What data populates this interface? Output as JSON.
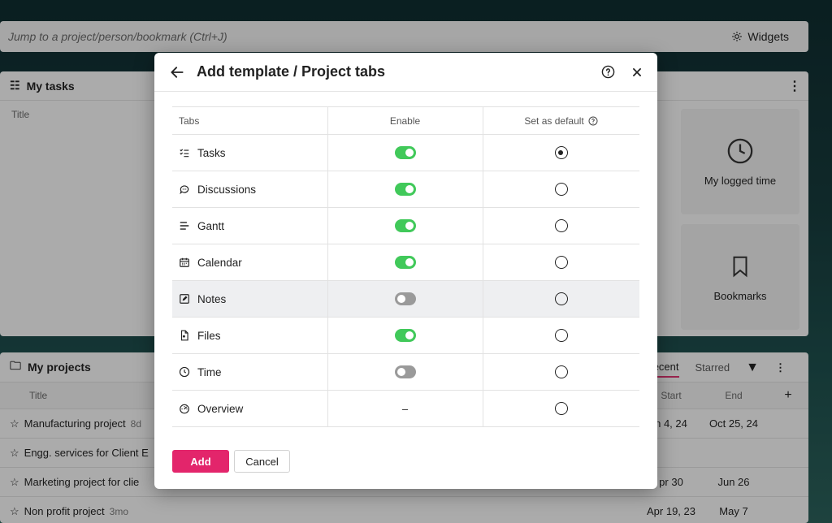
{
  "background": {
    "search_placeholder": "Jump to a project/person/bookmark (Ctrl+J)",
    "widgets_label": "Widgets",
    "my_tasks": {
      "title": "My tasks",
      "col_title": "Title"
    },
    "widget_cards": [
      {
        "label": "My logged time",
        "icon": "clock-icon"
      },
      {
        "label": "Bookmarks",
        "icon": "bookmark-icon"
      }
    ],
    "my_projects": {
      "title": "My projects",
      "tab_recent": "ecent",
      "tab_starred": "Starred",
      "col_title": "Title",
      "col_start": "Start",
      "col_end": "End",
      "rows": [
        {
          "name": "Manufacturing project",
          "age": "8d",
          "start": "n 4, 24",
          "end": "Oct 25, 24"
        },
        {
          "name": "Engg. services for Client E",
          "age": "",
          "start": "",
          "end": ""
        },
        {
          "name": "Marketing project for clie",
          "age": "",
          "start": "pr 30",
          "end": "Jun 26"
        },
        {
          "name": "Non profit project",
          "age": "3mo",
          "start": "Apr 19, 23",
          "end": "May 7"
        }
      ]
    }
  },
  "modal": {
    "title": "Add template / Project tabs",
    "columns": {
      "tabs": "Tabs",
      "enable": "Enable",
      "default": "Set as default"
    },
    "rows": [
      {
        "label": "Tasks",
        "icon": "task-list-icon",
        "enabled": true,
        "default": true,
        "highlight": false
      },
      {
        "label": "Discussions",
        "icon": "chat-bubble-icon",
        "enabled": true,
        "default": false,
        "highlight": false
      },
      {
        "label": "Gantt",
        "icon": "gantt-icon",
        "enabled": true,
        "default": false,
        "highlight": false
      },
      {
        "label": "Calendar",
        "icon": "calendar-icon",
        "enabled": true,
        "default": false,
        "highlight": false
      },
      {
        "label": "Notes",
        "icon": "notes-icon",
        "enabled": false,
        "default": false,
        "highlight": true
      },
      {
        "label": "Files",
        "icon": "file-icon",
        "enabled": true,
        "default": false,
        "highlight": false
      },
      {
        "label": "Time",
        "icon": "clock-icon",
        "enabled": false,
        "default": false,
        "highlight": false
      },
      {
        "label": "Overview",
        "icon": "gauge-icon",
        "enabled": null,
        "enable_text": "–",
        "default": false,
        "highlight": false
      }
    ],
    "buttons": {
      "add": "Add",
      "cancel": "Cancel"
    }
  },
  "colors": {
    "toggle_on": "#41c95a",
    "toggle_off": "#9a9a9a",
    "primary": "#e3256b"
  }
}
